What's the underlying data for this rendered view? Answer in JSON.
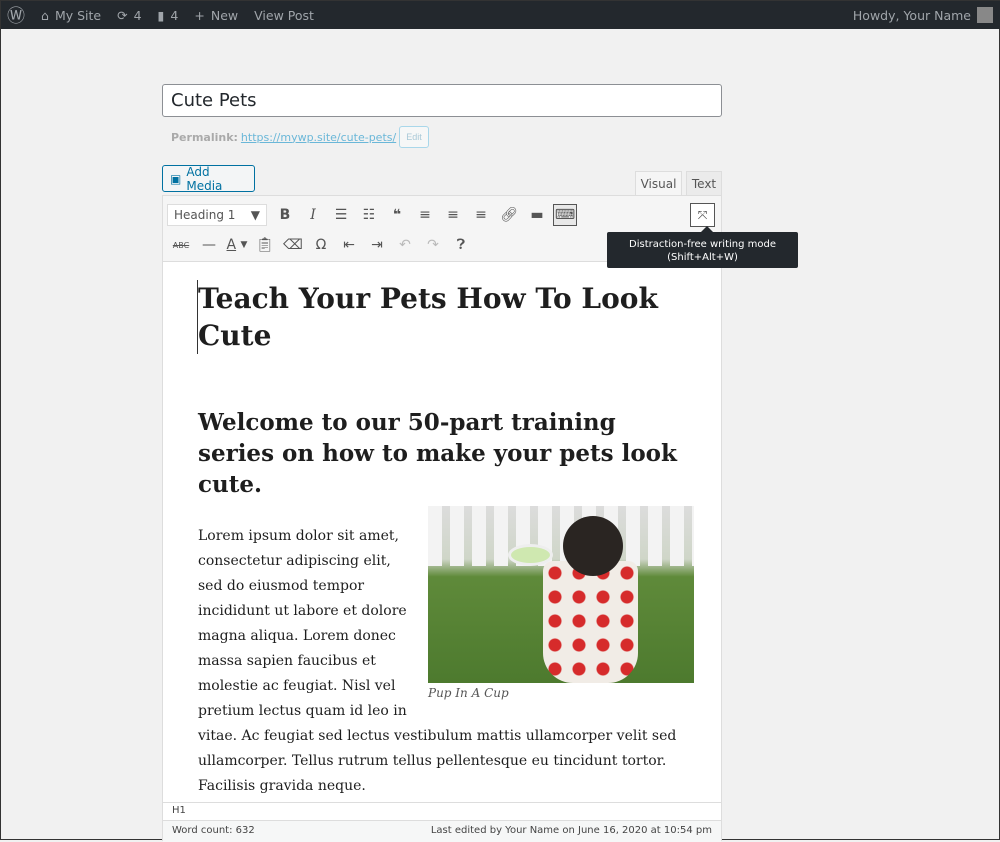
{
  "adminbar": {
    "site": "My Site",
    "updates": "4",
    "comments": "4",
    "new": "New",
    "view_post": "View Post",
    "howdy": "Howdy, Your Name"
  },
  "post": {
    "title": "Cute Pets",
    "permalink_label": "Permalink:",
    "permalink_url": "https://mywp.site/cute-pets/",
    "edit_label": "Edit"
  },
  "editor": {
    "add_media": "Add Media",
    "tabs": [
      "Visual",
      "Text"
    ],
    "format_select": "Heading 1",
    "tooltip_line1": "Distraction-free writing mode",
    "tooltip_line2": "(Shift+Alt+W)",
    "toolbar_icons": {
      "row1": [
        "bold-icon",
        "italic-icon",
        "bulleted-list-icon",
        "numbered-list-icon",
        "blockquote-icon",
        "align-left-icon",
        "align-center-icon",
        "align-right-icon",
        "link-icon",
        "read-more-icon",
        "toolbar-toggle-icon",
        "distraction-free-icon"
      ],
      "row2": [
        "strikethrough-icon",
        "horizontal-line-icon",
        "text-color-icon",
        "paste-text-icon",
        "clear-formatting-icon",
        "special-character-icon",
        "outdent-icon",
        "indent-icon",
        "undo-icon",
        "redo-icon",
        "help-icon"
      ]
    }
  },
  "content": {
    "h1": "Teach Your Pets How To Look Cute",
    "h2": "Welcome to our 50-part training series on how to make your pets look cute.",
    "paragraph": "Lorem ipsum dolor sit amet, consectetur adipiscing elit, sed do eiusmod tempor incididunt ut labore et dolore magna aliqua. Lorem donec massa sapien faucibus et molestie ac feugiat. Nisl vel pretium lectus quam id leo in vitae. Ac feugiat sed lectus vestibulum mattis ullamcorper velit sed ullamcorper. Tellus rutrum tellus pellentesque eu tincidunt tortor. Facilisis gravida neque.",
    "image_caption": "Pup In A Cup"
  },
  "statusbar": {
    "path": "H1",
    "word_count": "Word count: 632",
    "last_edited": "Last edited by Your Name on June 16, 2020 at 10:54 pm"
  }
}
